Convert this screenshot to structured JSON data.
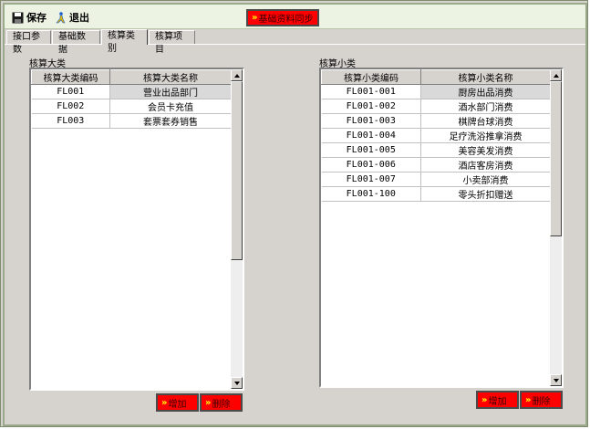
{
  "toolbar": {
    "save_label": "保存",
    "exit_label": "退出",
    "sync_label": "基础资料同步"
  },
  "tabs": [
    {
      "label": "接口参数"
    },
    {
      "label": "基础数据"
    },
    {
      "label": "核算类别"
    },
    {
      "label": "核算项目"
    }
  ],
  "active_tab": "核算类别",
  "major": {
    "group_label": "核算大类",
    "columns": [
      "核算大类编码",
      "核算大类名称"
    ],
    "rows": [
      {
        "code": "FL001",
        "name": "营业出品部门"
      },
      {
        "code": "FL002",
        "name": "会员卡充值"
      },
      {
        "code": "FL003",
        "name": "套票套券销售"
      }
    ],
    "add_label": "增加",
    "delete_label": "删除"
  },
  "minor": {
    "group_label": "核算小类",
    "columns": [
      "核算小类编码",
      "核算小类名称"
    ],
    "rows": [
      {
        "code": "FL001-001",
        "name": "厨房出品消费"
      },
      {
        "code": "FL001-002",
        "name": "酒水部门消费"
      },
      {
        "code": "FL001-003",
        "name": "棋牌台球消费"
      },
      {
        "code": "FL001-004",
        "name": "足疗洗浴推拿消费"
      },
      {
        "code": "FL001-005",
        "name": "美容美发消费"
      },
      {
        "code": "FL001-006",
        "name": "酒店客房消费"
      },
      {
        "code": "FL001-007",
        "name": "小卖部消费"
      },
      {
        "code": "FL001-100",
        "name": "零头折扣赠送"
      }
    ],
    "add_label": "增加",
    "delete_label": "删除"
  },
  "colors": {
    "button_red": "#ff0000",
    "toolbar_bg": "#ecf3e2",
    "window_bg": "#d6d3ce"
  },
  "icons": [
    "save-icon",
    "exit-icon"
  ]
}
